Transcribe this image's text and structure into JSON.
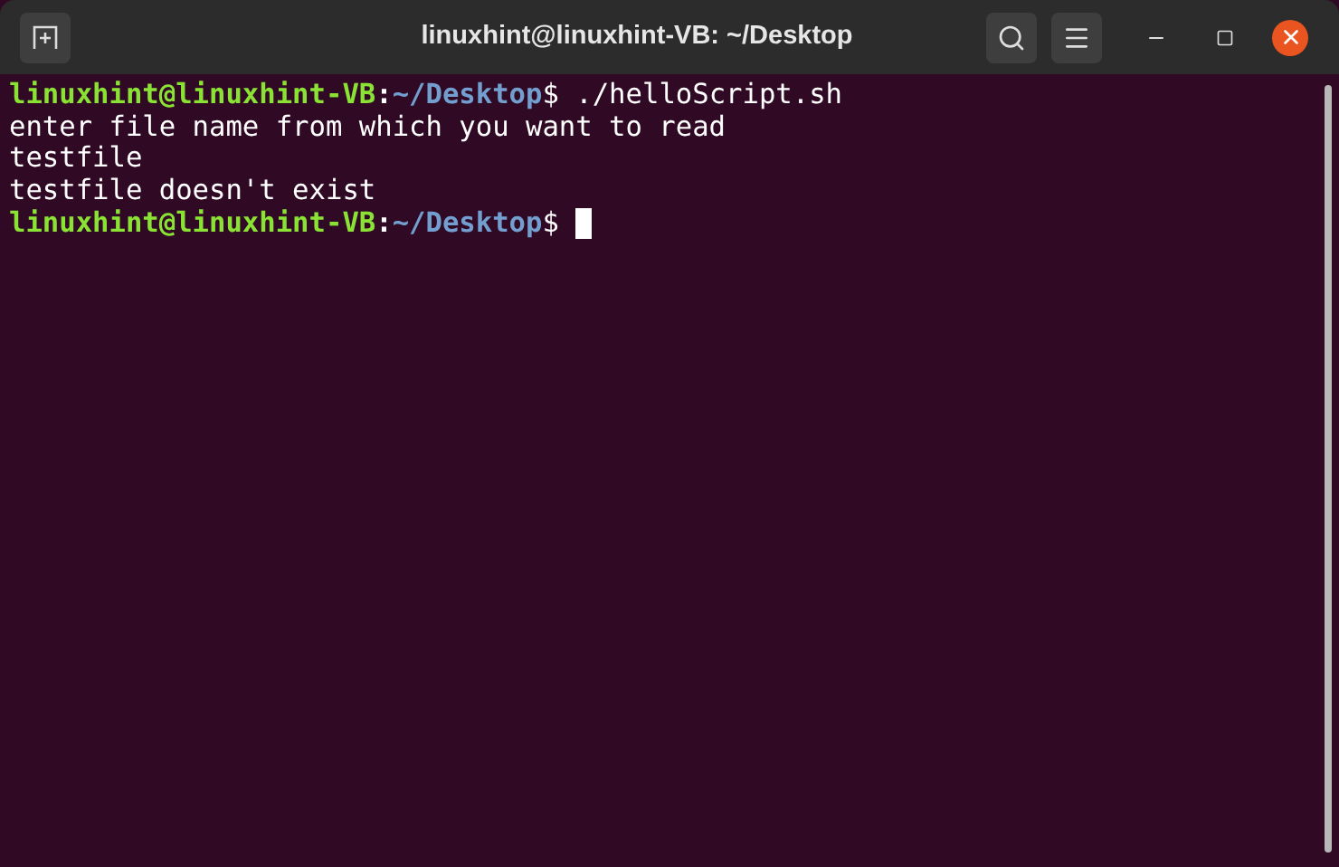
{
  "window": {
    "title": "linuxhint@linuxhint-VB: ~/Desktop"
  },
  "terminal": {
    "lines": [
      {
        "kind": "prompt",
        "user": "linuxhint@linuxhint-VB",
        "separator": ":",
        "path": "~/Desktop",
        "symbol": "$ ",
        "command": "./helloScript.sh",
        "cursor": false
      },
      {
        "kind": "output",
        "text": "enter file name from which you want to read"
      },
      {
        "kind": "output",
        "text": "testfile"
      },
      {
        "kind": "output",
        "text": "testfile doesn't exist"
      },
      {
        "kind": "prompt",
        "user": "linuxhint@linuxhint-VB",
        "separator": ":",
        "path": "~/Desktop",
        "symbol": "$ ",
        "cursor": true
      }
    ]
  }
}
